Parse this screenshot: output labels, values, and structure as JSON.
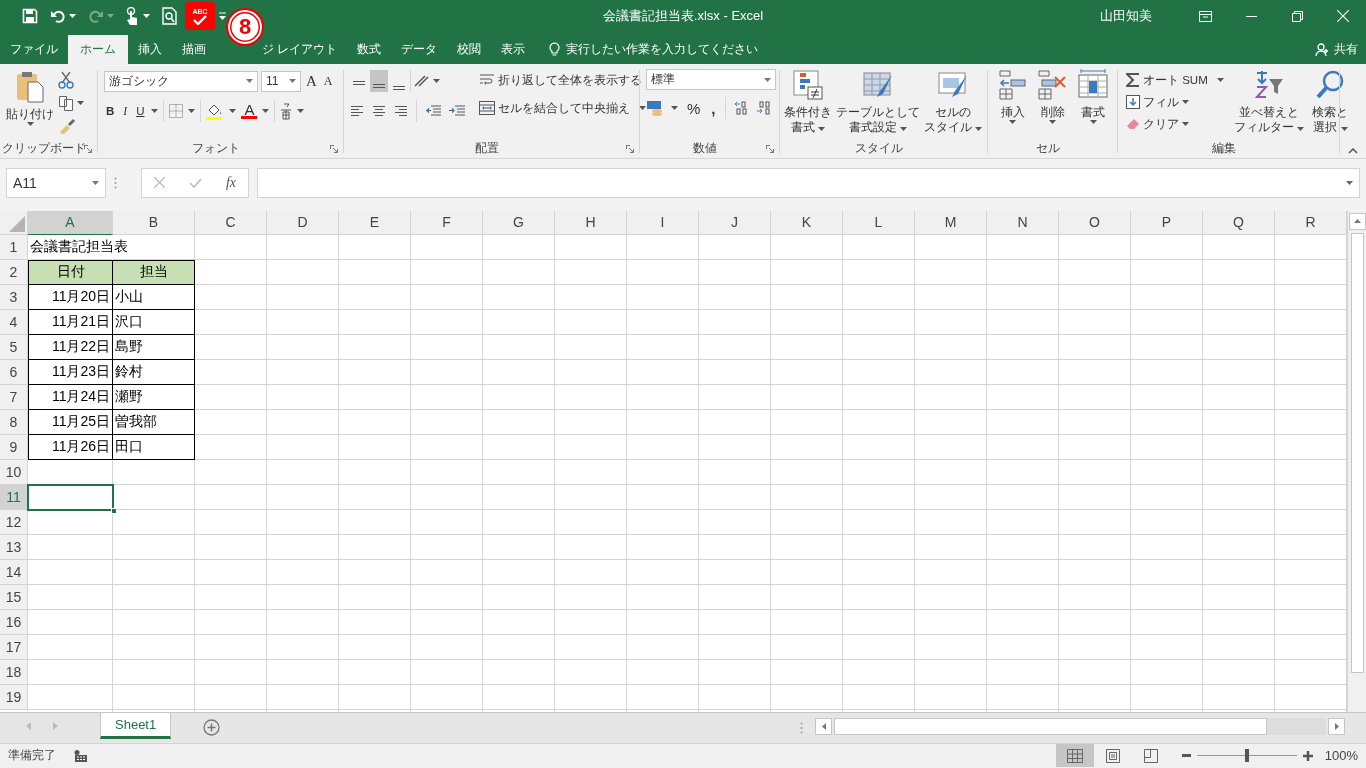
{
  "window": {
    "title": "会議書記担当表.xlsx - Excel",
    "user": "山田知美"
  },
  "quick_access": [
    {
      "kind": "save",
      "disabled": false,
      "highlighted": false
    },
    {
      "kind": "undo",
      "disabled": false,
      "highlighted": false
    },
    {
      "kind": "redo",
      "disabled": true,
      "highlighted": false
    },
    {
      "kind": "touch",
      "disabled": false,
      "highlighted": false
    },
    {
      "kind": "preview",
      "disabled": false,
      "highlighted": false
    },
    {
      "kind": "spelling",
      "disabled": false,
      "highlighted": true,
      "text": "ABC"
    },
    {
      "kind": "customize",
      "disabled": false,
      "highlighted": false
    }
  ],
  "callout": "8",
  "ribbon_tabs": [
    {
      "label": "ファイル",
      "selected": false,
      "covered": false
    },
    {
      "label": "ホーム",
      "selected": true,
      "covered": false
    },
    {
      "label": "挿入",
      "selected": false,
      "covered": false
    },
    {
      "label": "描画",
      "selected": false,
      "covered": false
    },
    {
      "label": "ジ レイアウト",
      "selected": false,
      "covered": true
    },
    {
      "label": "数式",
      "selected": false,
      "covered": false
    },
    {
      "label": "データ",
      "selected": false,
      "covered": false
    },
    {
      "label": "校閲",
      "selected": false,
      "covered": false
    },
    {
      "label": "表示",
      "selected": false,
      "covered": false
    }
  ],
  "tell_me": "実行したい作業を入力してください",
  "share": "共有",
  "ribbon": {
    "clipboard": {
      "paste": "貼り付け",
      "label": "クリップボード"
    },
    "font": {
      "name": "游ゴシック",
      "size": "11",
      "grow": "A",
      "shrink": "A",
      "bold": "B",
      "italic": "I",
      "underline": "U",
      "font_color": "A",
      "label": "フォント"
    },
    "alignment": {
      "valign": [
        {
          "selected": false
        },
        {
          "selected": true
        },
        {
          "selected": false
        }
      ],
      "wrap": "折り返して全体を表示する",
      "merge": "セルを結合して中央揃え",
      "label": "配置"
    },
    "number": {
      "format": "標準",
      "percent": "%",
      "comma": ",",
      "label": "数値"
    },
    "styles": {
      "buttons": [
        {
          "kind": "conditional",
          "lines": [
            "条件付き",
            "書式"
          ]
        },
        {
          "kind": "table",
          "lines": [
            "テーブルとして",
            "書式設定"
          ]
        },
        {
          "kind": "cell",
          "lines": [
            "セルの",
            "スタイル"
          ]
        }
      ],
      "label": "スタイル"
    },
    "cells": {
      "buttons": [
        {
          "kind": "insert",
          "label": "挿入"
        },
        {
          "kind": "delete",
          "label": "削除"
        },
        {
          "kind": "format",
          "label": "書式"
        }
      ],
      "label": "セル"
    },
    "editing": {
      "autosum": "オート SUM",
      "fill": "フィル",
      "clear": "クリア",
      "sort": [
        "並べ替えと",
        "フィルター"
      ],
      "find": [
        "検索と",
        "選択"
      ],
      "label": "編集"
    }
  },
  "formula_bar": {
    "name_box": "A11",
    "fx": "fx"
  },
  "columns": [
    {
      "label": "A",
      "selected": true
    },
    {
      "label": "B",
      "selected": false
    },
    {
      "label": "C",
      "selected": false
    },
    {
      "label": "D",
      "selected": false
    },
    {
      "label": "E",
      "selected": false
    },
    {
      "label": "F",
      "selected": false
    },
    {
      "label": "G",
      "selected": false
    },
    {
      "label": "H",
      "selected": false
    },
    {
      "label": "I",
      "selected": false
    },
    {
      "label": "J",
      "selected": false
    },
    {
      "label": "K",
      "selected": false
    },
    {
      "label": "L",
      "selected": false
    },
    {
      "label": "M",
      "selected": false
    },
    {
      "label": "N",
      "selected": false
    },
    {
      "label": "O",
      "selected": false
    },
    {
      "label": "P",
      "selected": false
    },
    {
      "label": "Q",
      "selected": false
    },
    {
      "label": "R",
      "selected": false
    }
  ],
  "rows": [
    {
      "header": "1",
      "kind": "title",
      "selected": false,
      "a": "会議書記担当表"
    },
    {
      "header": "2",
      "kind": "head",
      "selected": false,
      "a": "日付",
      "b": "担当"
    },
    {
      "header": "3",
      "kind": "data",
      "selected": false,
      "a": "11月20日",
      "b": "小山"
    },
    {
      "header": "4",
      "kind": "data",
      "selected": false,
      "a": "11月21日",
      "b": "沢口"
    },
    {
      "header": "5",
      "kind": "data",
      "selected": false,
      "a": "11月22日",
      "b": "島野"
    },
    {
      "header": "6",
      "kind": "data",
      "selected": false,
      "a": "11月23日",
      "b": "鈴村"
    },
    {
      "header": "7",
      "kind": "data",
      "selected": false,
      "a": "11月24日",
      "b": "瀬野"
    },
    {
      "header": "8",
      "kind": "data",
      "selected": false,
      "a": "11月25日",
      "b": "曽我部"
    },
    {
      "header": "9",
      "kind": "data",
      "selected": false,
      "a": "11月26日",
      "b": "田口"
    },
    {
      "header": "10",
      "kind": "empty",
      "selected": false
    },
    {
      "header": "11",
      "kind": "empty",
      "selected": true
    },
    {
      "header": "12",
      "kind": "empty",
      "selected": false
    },
    {
      "header": "13",
      "kind": "empty",
      "selected": false
    },
    {
      "header": "14",
      "kind": "empty",
      "selected": false
    },
    {
      "header": "15",
      "kind": "empty",
      "selected": false
    },
    {
      "header": "16",
      "kind": "empty",
      "selected": false
    },
    {
      "header": "17",
      "kind": "empty",
      "selected": false
    },
    {
      "header": "18",
      "kind": "empty",
      "selected": false
    },
    {
      "header": "19",
      "kind": "empty",
      "selected": false
    }
  ],
  "sheet_tabs": [
    {
      "label": "Sheet1",
      "selected": true
    }
  ],
  "status": {
    "text": "準備完了",
    "views": [
      {
        "kind": "normal",
        "selected": true
      },
      {
        "kind": "page_layout",
        "selected": false
      },
      {
        "kind": "page_break",
        "selected": false
      }
    ],
    "zoom": {
      "level": 0.5
    },
    "zoom_text": "100%"
  }
}
